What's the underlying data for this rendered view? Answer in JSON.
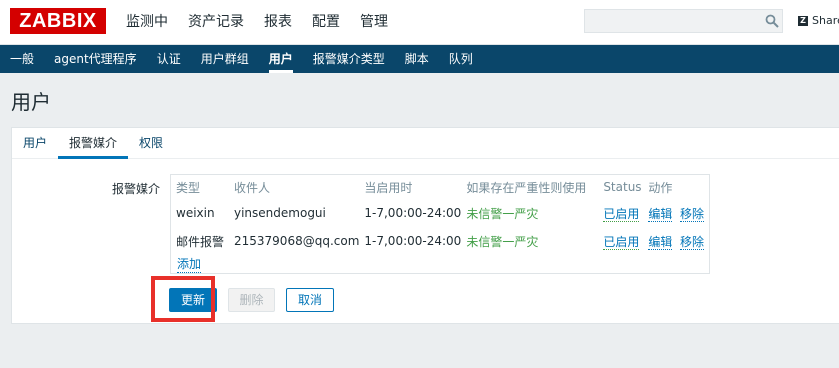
{
  "logo": "ZABBIX",
  "main_menu": [
    "监测中",
    "资产记录",
    "报表",
    "配置",
    "管理"
  ],
  "search": {
    "value": "",
    "placeholder": ""
  },
  "share_label": "Share",
  "sub_menu": [
    "一般",
    "agent代理程序",
    "认证",
    "用户群组",
    "用户",
    "报警媒介类型",
    "脚本",
    "队列"
  ],
  "sub_menu_active": "用户",
  "page_title": "用户",
  "tabs": [
    "用户",
    "报警媒介",
    "权限"
  ],
  "active_tab": "报警媒介",
  "media_label": "报警媒介",
  "table": {
    "headers": [
      "类型",
      "收件人",
      "当启用时",
      "如果存在严重性则使用",
      "Status",
      "动作"
    ],
    "rows": [
      {
        "type": "weixin",
        "recipient": "yinsendemogui",
        "when_active": "1-7,00:00-24:00",
        "severity": "未信警一严灾",
        "status": "已启用",
        "edit": "编辑",
        "remove": "移除"
      },
      {
        "type": "邮件报警",
        "recipient": "215379068@qq.com",
        "when_active": "1-7,00:00-24:00",
        "severity": "未信警一严灾",
        "status": "已启用",
        "edit": "编辑",
        "remove": "移除"
      }
    ],
    "add_label": "添加"
  },
  "buttons": {
    "update": "更新",
    "delete": "删除",
    "cancel": "取消"
  },
  "colors": {
    "brand": "#d40000",
    "nav": "#0a466a",
    "link": "#0275b8",
    "status_enabled": "#429e47",
    "highlight": "#e8302a"
  }
}
